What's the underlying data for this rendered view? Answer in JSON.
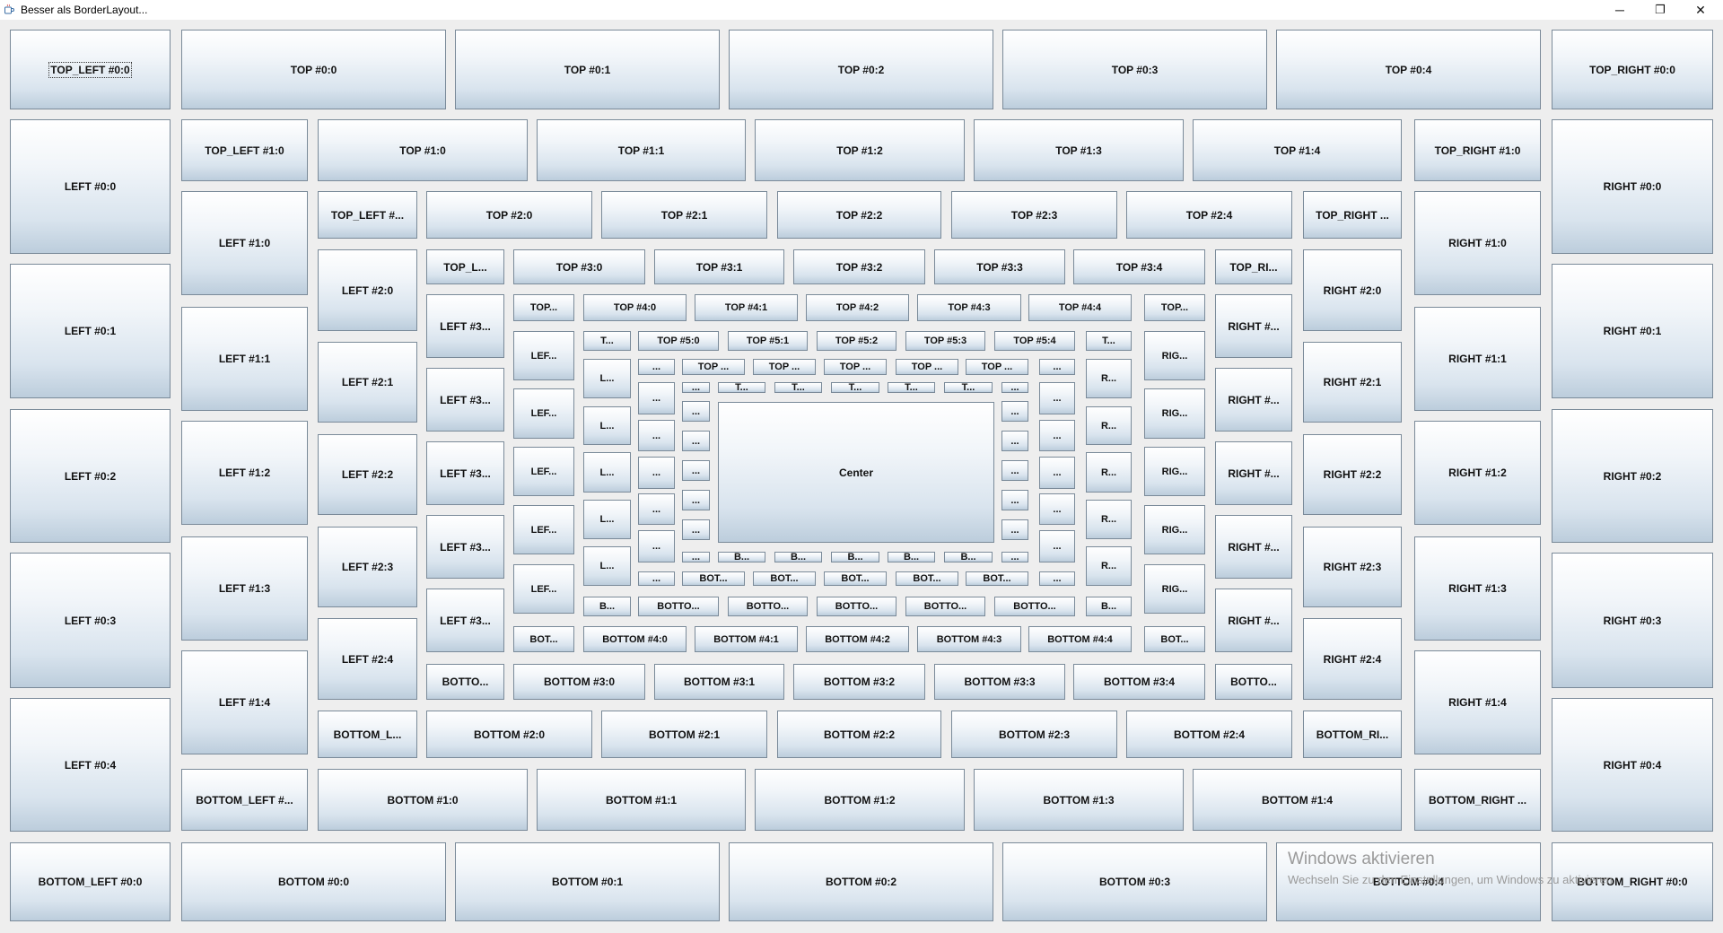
{
  "window": {
    "title": "Besser als BorderLayout...",
    "icon": "java-cup-icon",
    "controls": {
      "minimize": "─",
      "maximize": "❐",
      "close": "✕"
    }
  },
  "watermark": {
    "title": "Windows aktivieren",
    "subtitle": "Wechseln Sie zu den Einstellungen, um Windows zu aktivieren."
  },
  "colors": {
    "button_top": "#ffffff",
    "button_bottom": "#bccddc",
    "button_border": "#7a8a99",
    "background": "#eeeeee"
  },
  "focused_button": "TOP_LEFT #0:0",
  "buttons": {
    "top_0": [
      "TOP_LEFT #0:0",
      "TOP #0:0",
      "TOP #0:1",
      "TOP #0:2",
      "TOP #0:3",
      "TOP #0:4",
      "TOP_RIGHT #0:0"
    ],
    "left_0": [
      "LEFT #0:0",
      "LEFT #0:1",
      "LEFT #0:2",
      "LEFT #0:3",
      "LEFT #0:4"
    ],
    "right_0": [
      "RIGHT #0:0",
      "RIGHT #0:1",
      "RIGHT #0:2",
      "RIGHT #0:3",
      "RIGHT #0:4"
    ],
    "bottom_0": [
      "BOTTOM_LEFT #0:0",
      "BOTTOM #0:0",
      "BOTTOM #0:1",
      "BOTTOM #0:2",
      "BOTTOM #0:3",
      "BOTTOM #0:4",
      "BOTTOM_RIGHT #0:0"
    ],
    "top_1": [
      "TOP_LEFT #1:0",
      "TOP #1:0",
      "TOP #1:1",
      "TOP #1:2",
      "TOP #1:3",
      "TOP #1:4",
      "TOP_RIGHT #1:0"
    ],
    "left_1": [
      "LEFT #1:0",
      "LEFT #1:1",
      "LEFT #1:2",
      "LEFT #1:3",
      "LEFT #1:4"
    ],
    "right_1": [
      "RIGHT #1:0",
      "RIGHT #1:1",
      "RIGHT #1:2",
      "RIGHT #1:3",
      "RIGHT #1:4"
    ],
    "bottom_1": [
      "BOTTOM_LEFT #...",
      "BOTTOM #1:0",
      "BOTTOM #1:1",
      "BOTTOM #1:2",
      "BOTTOM #1:3",
      "BOTTOM #1:4",
      "BOTTOM_RIGHT ..."
    ],
    "top_2": [
      "TOP_LEFT #...",
      "TOP #2:0",
      "TOP #2:1",
      "TOP #2:2",
      "TOP #2:3",
      "TOP #2:4",
      "TOP_RIGHT ..."
    ],
    "left_2": [
      "LEFT #2:0",
      "LEFT #2:1",
      "LEFT #2:2",
      "LEFT #2:3",
      "LEFT #2:4"
    ],
    "right_2": [
      "RIGHT #2:0",
      "RIGHT #2:1",
      "RIGHT #2:2",
      "RIGHT #2:3",
      "RIGHT #2:4"
    ],
    "bottom_2": [
      "BOTTOM_L...",
      "BOTTOM #2:0",
      "BOTTOM #2:1",
      "BOTTOM #2:2",
      "BOTTOM #2:3",
      "BOTTOM #2:4",
      "BOTTOM_RI..."
    ],
    "top_3": [
      "TOP_L...",
      "TOP #3:0",
      "TOP #3:1",
      "TOP #3:2",
      "TOP #3:3",
      "TOP #3:4",
      "TOP_RI..."
    ],
    "left_3": [
      "LEFT #3...",
      "LEFT #3...",
      "LEFT #3...",
      "LEFT #3...",
      "LEFT #3..."
    ],
    "right_3": [
      "RIGHT #...",
      "RIGHT #...",
      "RIGHT #...",
      "RIGHT #...",
      "RIGHT #..."
    ],
    "bottom_3": [
      "BOTTO...",
      "BOTTOM #3:0",
      "BOTTOM #3:1",
      "BOTTOM #3:2",
      "BOTTOM #3:3",
      "BOTTOM #3:4",
      "BOTTO..."
    ],
    "top_4": [
      "TOP...",
      "TOP #4:0",
      "TOP #4:1",
      "TOP #4:2",
      "TOP #4:3",
      "TOP #4:4",
      "TOP..."
    ],
    "left_4": [
      "LEF...",
      "LEF...",
      "LEF...",
      "LEF...",
      "LEF..."
    ],
    "right_4": [
      "RIG...",
      "RIG...",
      "RIG...",
      "RIG...",
      "RIG..."
    ],
    "bottom_4": [
      "BOT...",
      "BOTTOM #4:0",
      "BOTTOM #4:1",
      "BOTTOM #4:2",
      "BOTTOM #4:3",
      "BOTTOM #4:4",
      "BOT..."
    ],
    "top_5": [
      "T...",
      "TOP #5:0",
      "TOP #5:1",
      "TOP #5:2",
      "TOP #5:3",
      "TOP #5:4",
      "T..."
    ],
    "left_5": [
      "L...",
      "L...",
      "L...",
      "L...",
      "L..."
    ],
    "right_5": [
      "R...",
      "R...",
      "R...",
      "R...",
      "R..."
    ],
    "bottom_5": [
      "B...",
      "BOTTO...",
      "BOTTO...",
      "BOTTO...",
      "BOTTO...",
      "BOTTO...",
      "B..."
    ],
    "top_6": [
      "...",
      "TOP ...",
      "TOP ...",
      "TOP ...",
      "TOP ...",
      "TOP ...",
      "..."
    ],
    "left_6": [
      "...",
      "...",
      "...",
      "...",
      "..."
    ],
    "right_6": [
      "...",
      "...",
      "...",
      "...",
      "..."
    ],
    "bottom_6": [
      "...",
      "BOT...",
      "BOT...",
      "BOT...",
      "BOT...",
      "BOT...",
      "..."
    ],
    "top_7": [
      "...",
      "T...",
      "T...",
      "T...",
      "T...",
      "T...",
      "..."
    ],
    "left_7": [
      "...",
      "...",
      "...",
      "...",
      "..."
    ],
    "right_7": [
      "...",
      "...",
      "...",
      "...",
      "..."
    ],
    "bottom_7": [
      "...",
      "B...",
      "B...",
      "B...",
      "B...",
      "B...",
      "..."
    ],
    "center": [
      "Center"
    ]
  }
}
